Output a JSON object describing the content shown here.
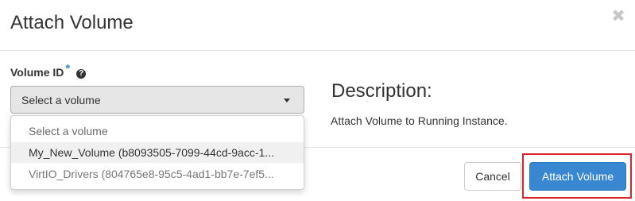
{
  "modal": {
    "title": "Attach Volume",
    "close_glyph": "✖"
  },
  "form": {
    "volume_label": "Volume ID",
    "required_mark": "*",
    "help_glyph": "?",
    "selected_value": "Select a volume",
    "options": [
      "Select a volume",
      "My_New_Volume (b8093505-7099-44cd-9acc-1...",
      "VirtIO_Drivers (804765e8-95c5-4ad1-bb7e-7ef5..."
    ]
  },
  "description": {
    "heading": "Description:",
    "text": "Attach Volume to Running Instance."
  },
  "footer": {
    "cancel_label": "Cancel",
    "attach_label": "Attach Volume"
  },
  "colors": {
    "primary": "#3a87d1",
    "highlight": "#e0202a"
  }
}
